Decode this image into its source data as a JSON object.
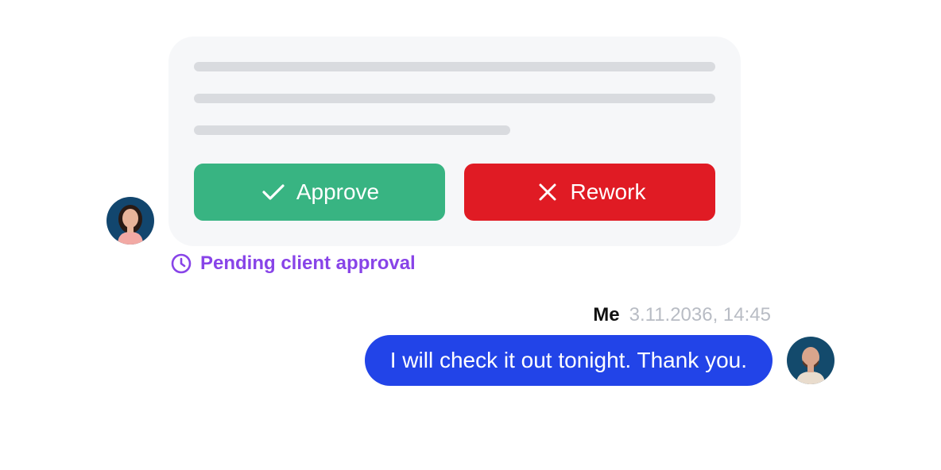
{
  "incoming_card": {
    "approve_label": "Approve",
    "approve_icon": "check-icon",
    "rework_label": "Rework",
    "rework_icon": "close-icon",
    "colors": {
      "card_bg": "#f6f7f9",
      "skeleton": "#d9dbdf",
      "approve": "#38b482",
      "rework": "#e01b24"
    }
  },
  "status": {
    "icon": "clock-icon",
    "text": "Pending client approval",
    "color": "#8844e8"
  },
  "outgoing_message": {
    "sender": "Me",
    "timestamp": "3.11.2036, 14:45",
    "text": "I will check it out tonight. Thank you.",
    "bubble_color": "#2244e8"
  }
}
